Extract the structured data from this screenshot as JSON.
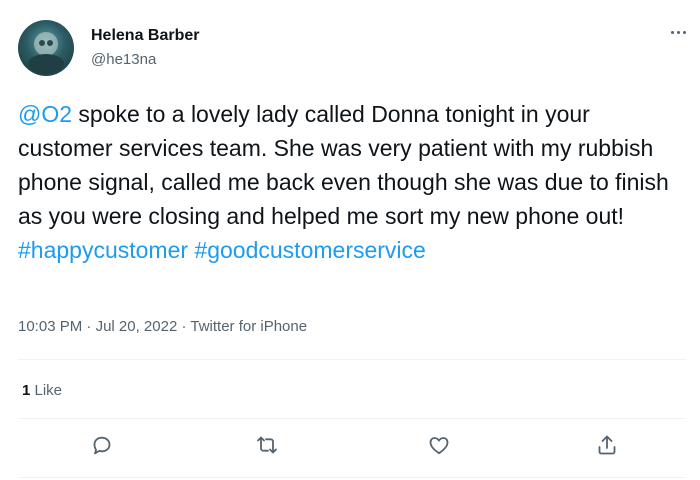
{
  "author": {
    "display_name": "Helena Barber",
    "handle": "@he13na"
  },
  "tweet": {
    "mention": "@O2",
    "text": " spoke to a lovely lady called Donna tonight in your customer services team. She was very patient with my rubbish phone signal, called me back even though she was due to finish as you were closing and helped me sort my new phone out! ",
    "hashtag_1": "#happycustomer",
    "hashtag_2": "#goodcustomerservice"
  },
  "meta": {
    "time": "10:03 PM",
    "separator_1": " · ",
    "date": "Jul 20, 2022",
    "separator_2": " · ",
    "source": "Twitter for iPhone"
  },
  "stats": {
    "like_count": "1",
    "like_label": " Like"
  },
  "icons": {
    "more": "more-icon",
    "reply": "reply-icon",
    "retweet": "retweet-icon",
    "like": "like-icon",
    "share": "share-icon"
  },
  "colors": {
    "link": "#1d9bf0",
    "text": "#0f1419",
    "secondary": "#536471"
  }
}
